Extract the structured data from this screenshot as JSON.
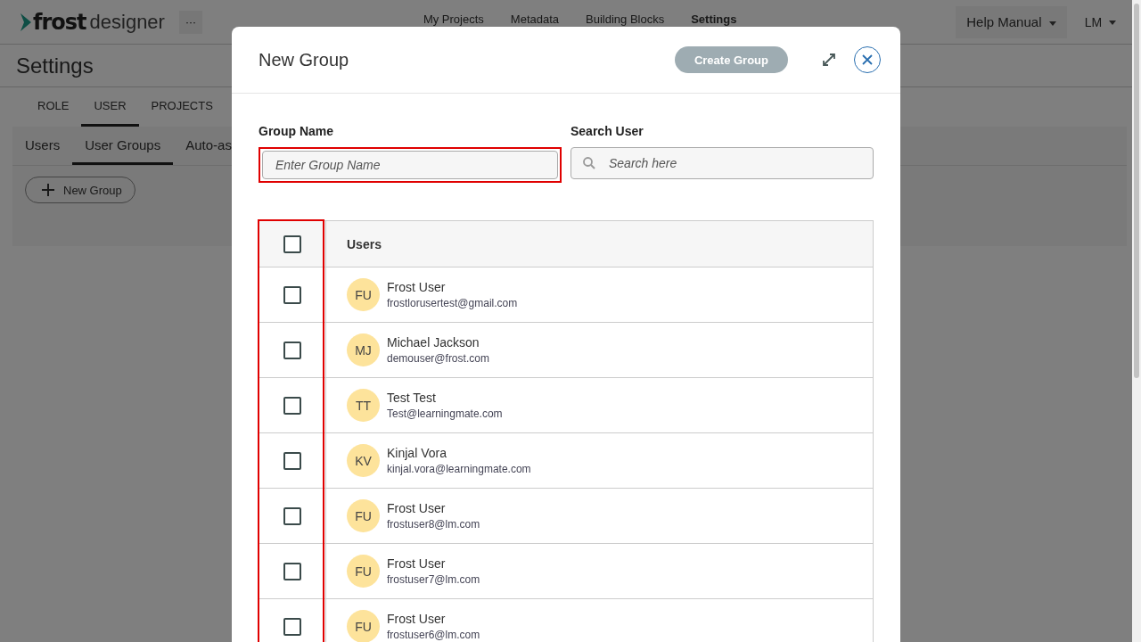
{
  "app": {
    "logo_word_1": "frost",
    "logo_word_2": "designer",
    "more": "···"
  },
  "nav": [
    {
      "label": "My Projects",
      "selected": false
    },
    {
      "label": "Metadata",
      "selected": false
    },
    {
      "label": "Building Blocks",
      "selected": false
    },
    {
      "label": "Settings",
      "selected": true
    }
  ],
  "help_menu": "Help Manual",
  "user_menu": "LM",
  "page_title": "Settings",
  "tabs": [
    {
      "label": "ROLE",
      "selected": false
    },
    {
      "label": "USER",
      "selected": true
    },
    {
      "label": "PROJECTS",
      "selected": false
    }
  ],
  "subtabs": [
    {
      "label": "Users",
      "selected": false
    },
    {
      "label": "User Groups",
      "selected": true
    },
    {
      "label": "Auto-as",
      "selected": false
    }
  ],
  "new_group_button": "New Group",
  "dialog": {
    "title": "New Group",
    "create_button": {
      "label": "Create Group",
      "disabled": true
    },
    "group_name": {
      "label": "Group Name",
      "placeholder": "Enter Group Name",
      "highlighted": true
    },
    "search": {
      "label": "Search User",
      "placeholder": "Search here"
    },
    "table": {
      "header": "Users",
      "select_all_checked": false,
      "checkbox_column_highlighted": true,
      "rows": [
        {
          "initials": "FU",
          "name": "Frost User",
          "email": "frostlorusertest@gmail.com",
          "checked": false
        },
        {
          "initials": "MJ",
          "name": "Michael Jackson",
          "email": "demouser@frost.com",
          "checked": false
        },
        {
          "initials": "TT",
          "name": "Test Test",
          "email": "Test@learningmate.com",
          "checked": false
        },
        {
          "initials": "KV",
          "name": "Kinjal Vora",
          "email": "kinjal.vora@learningmate.com",
          "checked": false
        },
        {
          "initials": "FU",
          "name": "Frost User",
          "email": "frostuser8@lm.com",
          "checked": false
        },
        {
          "initials": "FU",
          "name": "Frost User",
          "email": "frostuser7@lm.com",
          "checked": false
        },
        {
          "initials": "FU",
          "name": "Frost User",
          "email": "frostuser6@lm.com",
          "checked": false
        }
      ]
    }
  }
}
